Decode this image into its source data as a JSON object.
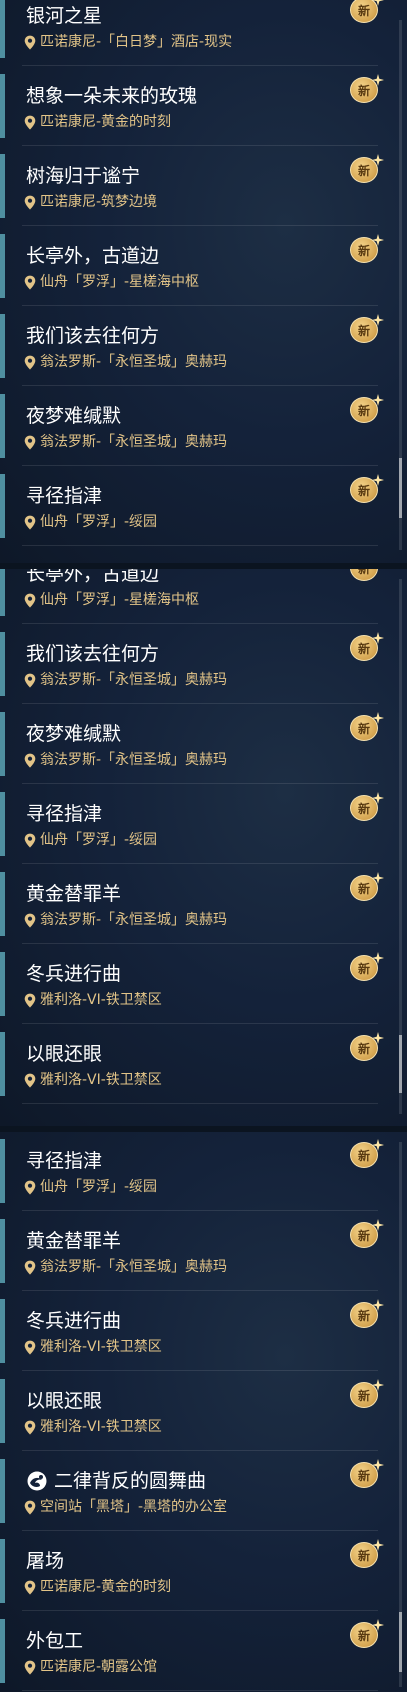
{
  "badge_label": "新",
  "panels": [
    {
      "items": [
        {
          "title": "银河之星",
          "location": "匹诺康尼-「白日梦」酒店-现实"
        },
        {
          "title": "想象一朵未来的玫瑰",
          "location": "匹诺康尼-黄金的时刻"
        },
        {
          "title": "树海归于谧宁",
          "location": "匹诺康尼-筑梦边境"
        },
        {
          "title": "长亭外，古道边",
          "location": "仙舟「罗浮」-星槎海中枢"
        },
        {
          "title": "我们该去往何方",
          "location": "翁法罗斯-「永恒圣城」奥赫玛"
        },
        {
          "title": "夜梦难缄默",
          "location": "翁法罗斯-「永恒圣城」奥赫玛"
        },
        {
          "title": "寻径指津",
          "location": "仙舟「罗浮」-绥园"
        }
      ]
    },
    {
      "items": [
        {
          "title": "长亭外，古道边",
          "location": "仙舟「罗浮」-星槎海中枢"
        },
        {
          "title": "我们该去往何方",
          "location": "翁法罗斯-「永恒圣城」奥赫玛"
        },
        {
          "title": "夜梦难缄默",
          "location": "翁法罗斯-「永恒圣城」奥赫玛"
        },
        {
          "title": "寻径指津",
          "location": "仙舟「罗浮」-绥园"
        },
        {
          "title": "黄金替罪羊",
          "location": "翁法罗斯-「永恒圣城」奥赫玛"
        },
        {
          "title": "冬兵进行曲",
          "location": "雅利洛-VI-铁卫禁区"
        },
        {
          "title": "以眼还眼",
          "location": "雅利洛-VI-铁卫禁区"
        }
      ]
    },
    {
      "items": [
        {
          "title": "寻径指津",
          "location": "仙舟「罗浮」-绥园"
        },
        {
          "title": "黄金替罪羊",
          "location": "翁法罗斯-「永恒圣城」奥赫玛"
        },
        {
          "title": "冬兵进行曲",
          "location": "雅利洛-VI-铁卫禁区"
        },
        {
          "title": "以眼还眼",
          "location": "雅利洛-VI-铁卫禁区"
        },
        {
          "title": "二律背反的圆舞曲",
          "location": "空间站「黑塔」-黑塔的办公室",
          "icon": "mission-swirl-icon"
        },
        {
          "title": "屠场",
          "location": "匹诺康尼-黄金的时刻"
        },
        {
          "title": "外包工",
          "location": "匹诺康尼-朝露公馆"
        }
      ]
    }
  ],
  "colors": {
    "title": "#ffffff",
    "location": "#e2c488",
    "accent": "#4f8fa0",
    "badge": "#d4a450"
  }
}
